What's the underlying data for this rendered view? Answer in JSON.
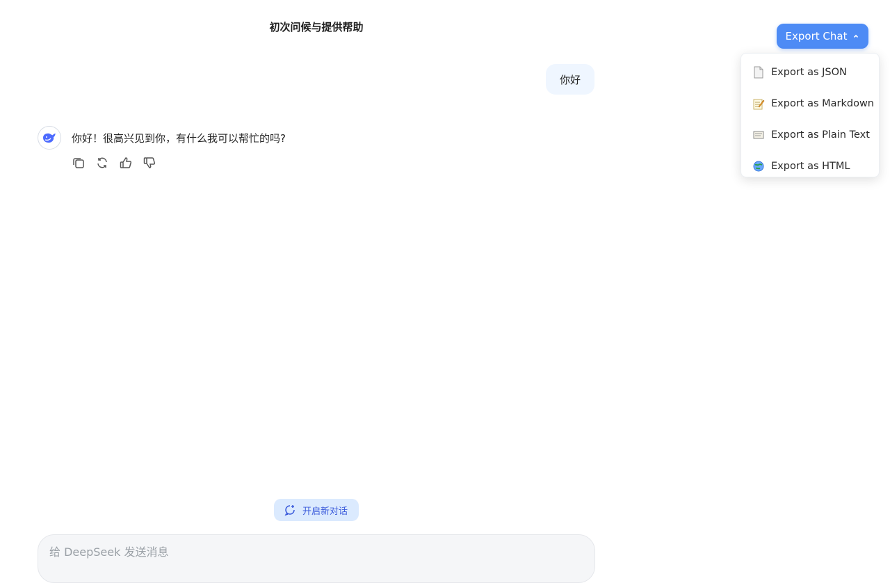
{
  "header": {
    "title": "初次问候与提供帮助"
  },
  "conversation": {
    "user_message": "你好",
    "assistant_message": "你好！很高兴见到你，有什么我可以帮忙的吗?"
  },
  "new_chat_label": "开启新对话",
  "composer": {
    "placeholder": "给 DeepSeek 发送消息"
  },
  "export": {
    "button_label": "Export Chat",
    "items": [
      {
        "label": "Export as JSON",
        "icon": "document-icon"
      },
      {
        "label": "Export as Markdown",
        "icon": "memo-icon"
      },
      {
        "label": "Export as Plain Text",
        "icon": "scroll-icon"
      },
      {
        "label": "Export as HTML",
        "icon": "globe-icon"
      }
    ]
  },
  "colors": {
    "accent": "#4d8bf5",
    "user_bubble": "#eff6ff",
    "new_chat_bg": "#dbeafe"
  }
}
